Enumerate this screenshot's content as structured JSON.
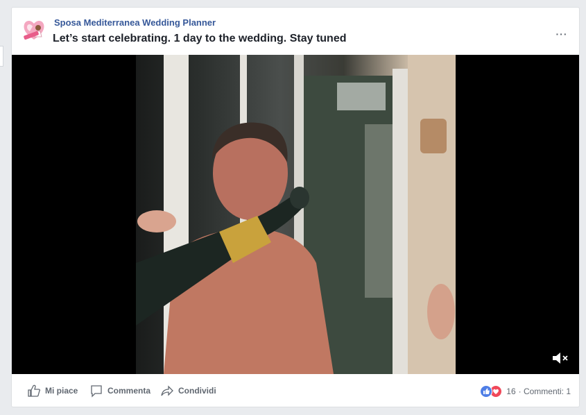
{
  "post": {
    "page_name": "Sposa Mediterranea Wedding Planner",
    "text": "Let’s start celebrating. 1 day to the wedding. Stay tuned",
    "more_label": "···"
  },
  "actions": {
    "like": "Mi piace",
    "comment": "Commenta",
    "share": "Condividi"
  },
  "stats": {
    "reaction_count": "16",
    "comments": "· Commenti: 1"
  },
  "icons": {
    "avatar": "wedding-logo-icon",
    "more": "ellipsis-icon",
    "mute": "speaker-muted-icon",
    "like": "thumbs-up-icon",
    "comment": "comment-bubble-icon",
    "share": "share-arrow-icon",
    "reaction_like": "like-reaction-icon",
    "reaction_love": "love-reaction-icon"
  },
  "colors": {
    "page_name": "#365899",
    "like_reaction": "#4f7ee6",
    "love_reaction": "#f0485a"
  }
}
